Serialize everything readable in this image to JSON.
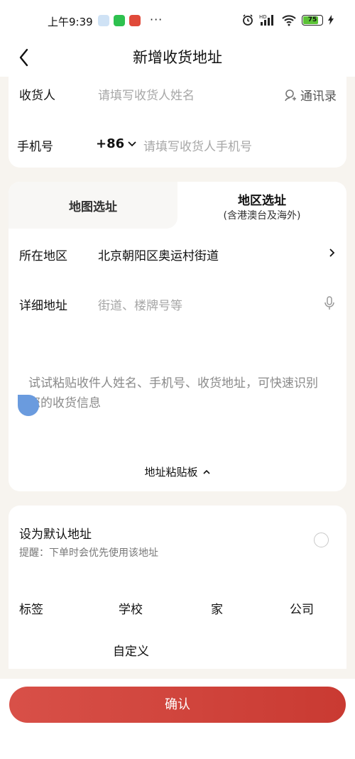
{
  "status_bar": {
    "time": "上午9:39",
    "more": "···",
    "battery": "75",
    "network": "HD"
  },
  "nav": {
    "title": "新增收货地址"
  },
  "contact": {
    "name_label": "收货人",
    "name_placeholder": "请填写收货人姓名",
    "contacts_label": "通讯录",
    "phone_label": "手机号",
    "country_code": "+86",
    "phone_placeholder": "请填写收货人手机号"
  },
  "address": {
    "tab_map": "地图选址",
    "tab_region": "地区选址",
    "tab_region_sub": "(含港澳台及海外)",
    "region_label": "所在地区",
    "region_value": "北京朝阳区奥运村街道",
    "detail_label": "详细地址",
    "detail_placeholder": "街道、楼牌号等",
    "paste_hint": "试试粘贴收件人姓名、手机号、收货地址，可快速识别您的收货信息",
    "clipboard_label": "地址粘贴板"
  },
  "settings": {
    "default_title": "设为默认地址",
    "default_tip": "提醒：下单时会优先使用该地址",
    "tag_label": "标签",
    "tags": [
      "学校",
      "家",
      "公司",
      "自定义"
    ]
  },
  "footer": {
    "confirm_label": "确认"
  },
  "colors": {
    "accent": "#d0443c",
    "page_bg": "#f7f4ef",
    "handle": "#6a9bde"
  }
}
